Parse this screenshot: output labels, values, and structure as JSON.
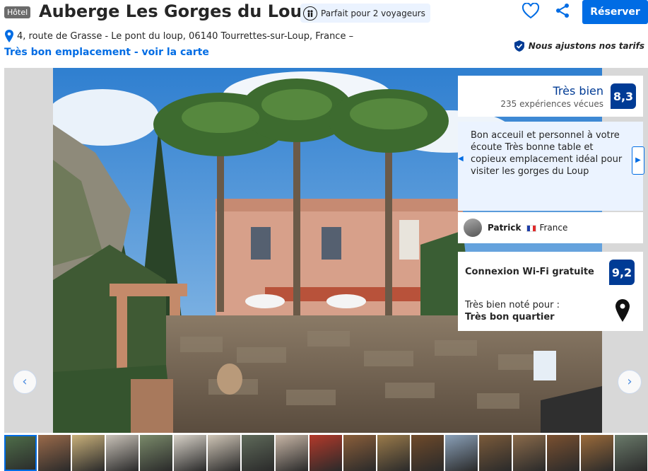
{
  "header": {
    "type_badge": "Hôtel",
    "hotel_name": "Auberge Les Gorges du Loup",
    "travelers_label": "Parfait pour 2 voyageurs",
    "reserve_label": "Réserver"
  },
  "address": {
    "text": "4, route de Grasse - Le pont du loup, 06140 Tourrettes-sur-Loup, France –",
    "location_link": "Très bon emplacement - voir la carte",
    "price_match": "Nous ajustons nos tarifs"
  },
  "review_summary": {
    "label": "Très bien",
    "count": "235 expériences vécues",
    "score": "8,3"
  },
  "review": {
    "text": "Bon acceuil et personnel à votre écoute Très bonne table et copieux emplacement idéal pour visiter les gorges du Loup",
    "author": "Patrick",
    "country": "France"
  },
  "wifi": {
    "label": "Connexion Wi-Fi gratuite",
    "score": "9,2"
  },
  "area": {
    "small_label": "Très bien noté pour :",
    "strong_label": "Très bon quartier"
  },
  "gallery": {
    "prev_arrow": "‹",
    "next_arrow": "›",
    "thumbnail_colors": [
      "#4f6f4a",
      "#9a6a4a",
      "#c9b07a",
      "#c9c2b8",
      "#7a8a6a",
      "#d8d2c8",
      "#cfc5b6",
      "#5f6a5a",
      "#c8b6a6",
      "#b3392a",
      "#8a5e3a",
      "#9a7a4a",
      "#6f4a2a",
      "#8aa0b8",
      "#7a5a3a",
      "#8a6a4a",
      "#7a5030",
      "#9a6a3a",
      "#6a7a6a"
    ]
  },
  "colors": {
    "brand_blue": "#006ce4",
    "dark_blue": "#003b95",
    "review_bg": "#ebf3ff"
  }
}
